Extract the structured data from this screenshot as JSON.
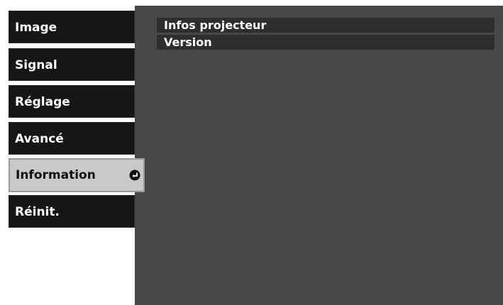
{
  "menu": {
    "items": [
      {
        "label": "Image",
        "selected": false
      },
      {
        "label": "Signal",
        "selected": false
      },
      {
        "label": "Réglage",
        "selected": false
      },
      {
        "label": "Avancé",
        "selected": false
      },
      {
        "label": "Information",
        "selected": true,
        "icon": "enter-icon"
      },
      {
        "label": "Réinit.",
        "selected": false
      }
    ]
  },
  "submenu": {
    "items": [
      {
        "label": "Infos projecteur"
      },
      {
        "label": "Version"
      }
    ]
  },
  "colors": {
    "menu_bg": "#161616",
    "menu_selected_bg": "#c9c9c9",
    "panel_bg": "#474747",
    "subitem_bg": "#2e2e2e",
    "text_light": "#ffffff",
    "text_dark": "#111111"
  }
}
